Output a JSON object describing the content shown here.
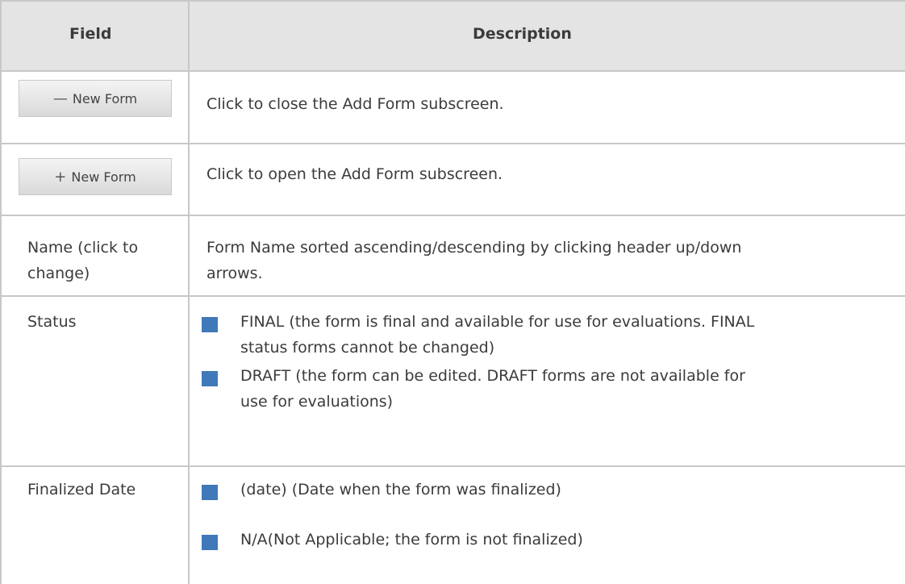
{
  "table": {
    "header": {
      "field": "Field",
      "description": "Description"
    },
    "rows": [
      {
        "field_button": {
          "icon": "minus-icon",
          "glyph": "—",
          "label": "New Form"
        },
        "description": "Click to close the Add Form subscreen."
      },
      {
        "field_button": {
          "icon": "plus-icon",
          "glyph": "+",
          "label": "New Form"
        },
        "description": "Click to open the Add Form subscreen."
      },
      {
        "field_lines": [
          "Name (click to",
          "change)"
        ],
        "description_lines": [
          "Form Name sorted ascending/descending by clicking header up/down",
          "arrows."
        ]
      },
      {
        "field": "Status",
        "bullets": [
          {
            "lines": [
              "FINAL (the form is final and available for use for evaluations. FINAL",
              "status forms cannot be changed)"
            ]
          },
          {
            "lines": [
              "DRAFT (the form can be edited. DRAFT forms are not available for",
              "use for evaluations)"
            ]
          }
        ]
      },
      {
        "field": "Finalized Date",
        "bullets": [
          {
            "lines": [
              "(date) (Date when the form was finalized)"
            ]
          },
          {
            "lines": [
              "N/A(Not Applicable; the form is not finalized)"
            ]
          }
        ]
      }
    ]
  },
  "colors": {
    "header_bg": "#e4e4e4",
    "border": "#c8c8c8",
    "bullet": "#3f79b7",
    "text": "#3b3b3b"
  }
}
